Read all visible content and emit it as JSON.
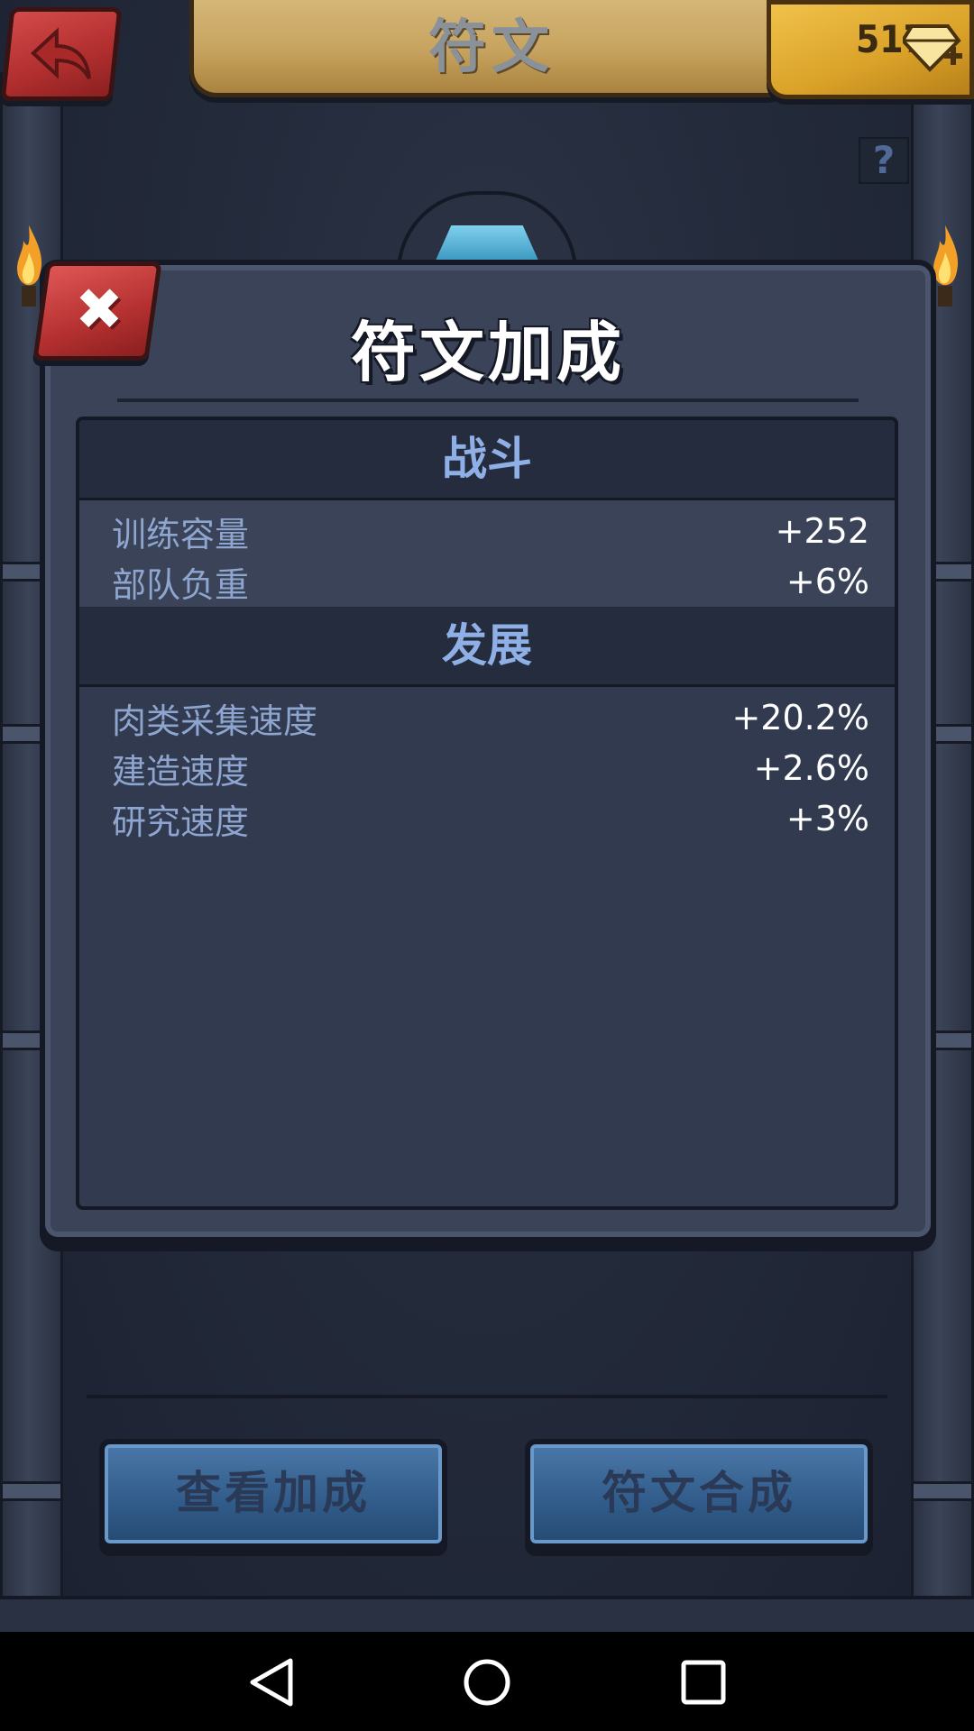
{
  "header": {
    "title": "符文",
    "gem_count": "517",
    "help_label": "?"
  },
  "dialog": {
    "title": "符文加成",
    "close_label": "✖",
    "sections": [
      {
        "header": "战斗",
        "rows": [
          {
            "label": "训练容量",
            "value": "+252"
          },
          {
            "label": "部队负重",
            "value": "+6%"
          }
        ]
      },
      {
        "header": "发展",
        "rows": [
          {
            "label": "肉类采集速度",
            "value": "+20.2%"
          },
          {
            "label": "建造速度",
            "value": "+2.6%"
          },
          {
            "label": "研究速度",
            "value": "+3%"
          }
        ]
      }
    ]
  },
  "buttons": {
    "view_bonus": "查看加成",
    "rune_synthesis": "符文合成"
  },
  "icons": {
    "back": "back-arrow-icon",
    "gem": "gem-plus-icon",
    "close": "close-icon",
    "torch": "torch-flame-icon",
    "nav_back": "nav-back-icon",
    "nav_home": "nav-home-icon",
    "nav_recents": "nav-recents-icon"
  },
  "colors": {
    "dialog_bg": "#3a4358",
    "section_header_text": "#8fb0e6",
    "row_label_text": "#8ea6cf",
    "button_blue": "#325d8c",
    "close_red": "#b43030",
    "banner_tan": "#c7a45f",
    "gem_gold": "#d9a128"
  }
}
